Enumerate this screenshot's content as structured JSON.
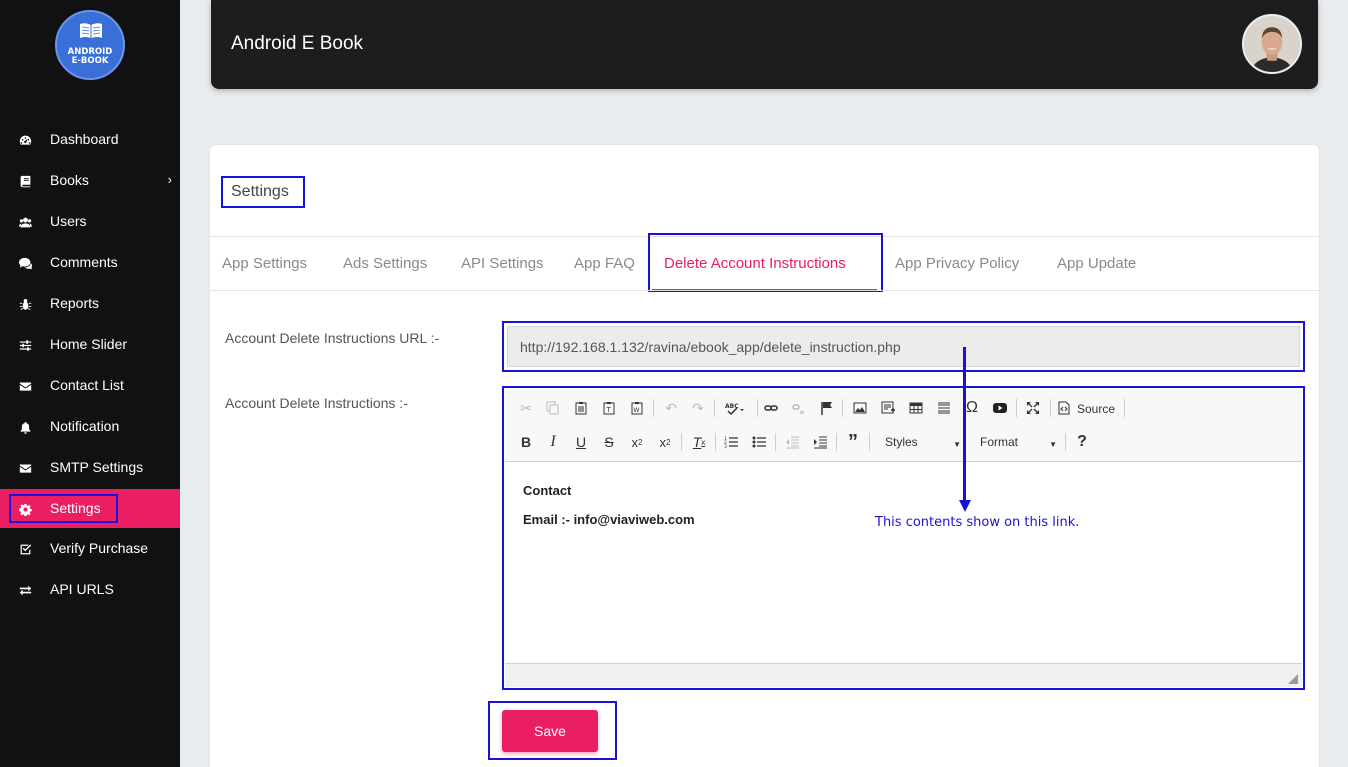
{
  "app": {
    "title": "Android E Book",
    "logo_line1": "ANDROID",
    "logo_line2": "E-BOOK"
  },
  "colors": {
    "accent": "#e91e63",
    "sidebar_bg": "#111111",
    "header_bg": "#1d1d1d",
    "annotation": "#1c12d6"
  },
  "sidebar": {
    "items": [
      {
        "label": "Dashboard",
        "icon": "dashboard-icon"
      },
      {
        "label": "Books",
        "icon": "book-icon",
        "has_submenu": true
      },
      {
        "label": "Users",
        "icon": "users-icon"
      },
      {
        "label": "Comments",
        "icon": "comments-icon"
      },
      {
        "label": "Reports",
        "icon": "bug-icon"
      },
      {
        "label": "Home Slider",
        "icon": "sliders-icon"
      },
      {
        "label": "Contact List",
        "icon": "envelope-icon"
      },
      {
        "label": "Notification",
        "icon": "bell-icon"
      },
      {
        "label": "SMTP Settings",
        "icon": "envelope-icon"
      },
      {
        "label": "Settings",
        "icon": "gear-icon",
        "active": true
      },
      {
        "label": "Verify Purchase",
        "icon": "check-square-icon"
      },
      {
        "label": "API URLS",
        "icon": "exchange-icon"
      }
    ]
  },
  "page": {
    "title": "Settings",
    "tabs": [
      {
        "label": "App Settings"
      },
      {
        "label": "Ads Settings"
      },
      {
        "label": "API Settings"
      },
      {
        "label": "App FAQ"
      },
      {
        "label": "Delete Account Instructions",
        "active": true
      },
      {
        "label": "App Privacy Policy"
      },
      {
        "label": "App Update"
      }
    ]
  },
  "form": {
    "url_label": "Account Delete Instructions URL :-",
    "url_value": "http://192.168.1.132/ravina/ebook_app/delete_instruction.php",
    "instructions_label": "Account Delete Instructions :-",
    "editor": {
      "source_label": "Source",
      "styles_label": "Styles",
      "format_label": "Format",
      "content_line1": "Contact",
      "content_line2": "Email :-  info@viaviweb.com"
    },
    "save_label": "Save"
  },
  "annotation": {
    "text": "This contents show on this link."
  }
}
